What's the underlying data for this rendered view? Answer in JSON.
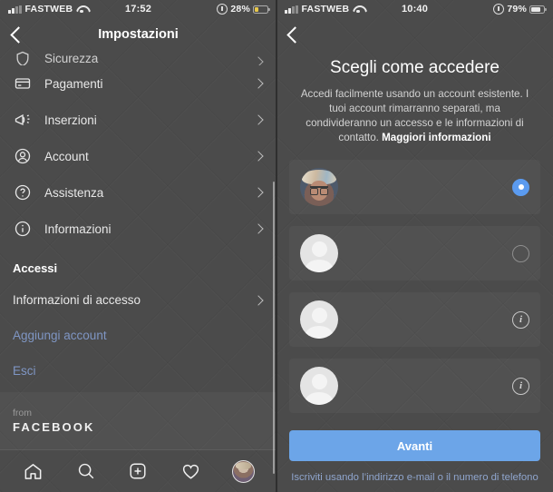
{
  "left": {
    "status": {
      "carrier": "FASTWEB",
      "time": "17:52",
      "battery_pct": "28%",
      "battery_color": "#e8c84a",
      "battery_level": 28
    },
    "nav": {
      "title": "Impostazioni",
      "back_icon": "chevron-left-icon"
    },
    "menu": [
      {
        "label": "Sicurezza",
        "icon": "shield-icon"
      },
      {
        "label": "Pagamenti",
        "icon": "credit-card-icon"
      },
      {
        "label": "Inserzioni",
        "icon": "megaphone-icon"
      },
      {
        "label": "Account",
        "icon": "person-circle-icon"
      },
      {
        "label": "Assistenza",
        "icon": "question-circle-icon"
      },
      {
        "label": "Informazioni",
        "icon": "info-circle-icon"
      }
    ],
    "section_accessi": "Accessi",
    "login_info": "Informazioni di accesso",
    "add_account": "Aggiungi account",
    "logout": "Esci",
    "footer": {
      "from": "from",
      "brand": "FACEBOOK"
    },
    "tabs": [
      {
        "name": "home-icon"
      },
      {
        "name": "search-icon"
      },
      {
        "name": "add-post-icon"
      },
      {
        "name": "heart-icon"
      },
      {
        "name": "profile-avatar"
      }
    ]
  },
  "right": {
    "status": {
      "carrier": "FASTWEB",
      "time": "10:40",
      "battery_pct": "79%",
      "battery_color": "#e8e8e8",
      "battery_level": 79
    },
    "nav": {
      "back_icon": "chevron-left-icon"
    },
    "title": "Scegli come accedere",
    "description": "Accedi facilmente usando un account esistente. I tuoi account rimarranno separati, ma condivideranno un accesso e le informazioni di contatto. ",
    "description_link": "Maggiori informazioni",
    "accounts": [
      {
        "avatar": "photo",
        "control": "radio-selected"
      },
      {
        "avatar": "placeholder",
        "control": "radio-empty"
      },
      {
        "avatar": "placeholder",
        "control": "info-icon"
      },
      {
        "avatar": "placeholder",
        "control": "info-icon"
      }
    ],
    "cta_label": "Avanti",
    "signup_label": "Iscriviti usando l’indirizzo e-mail o il numero di telefono",
    "accent_color": "#6ca5e8"
  }
}
